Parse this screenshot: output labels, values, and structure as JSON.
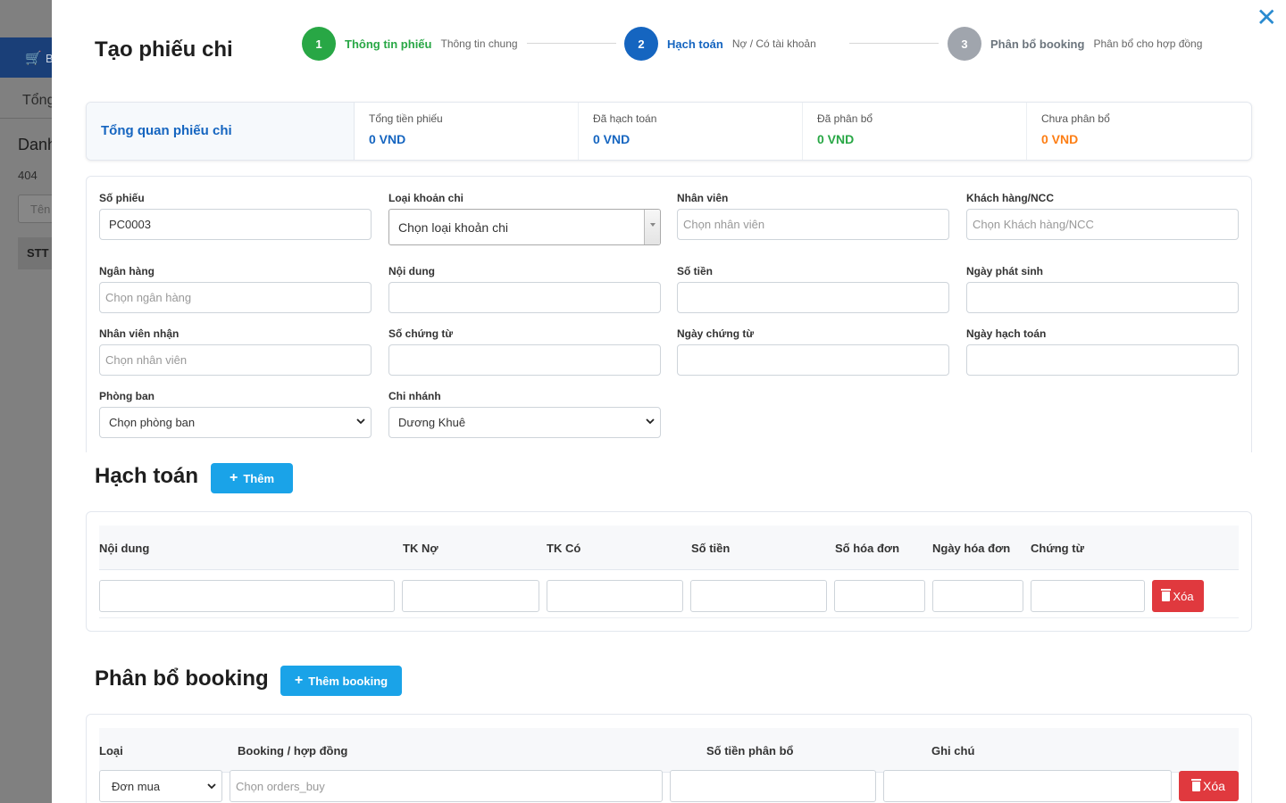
{
  "background": {
    "cart_label": "B",
    "tab_label": "Tổng",
    "title": "Danh",
    "count": "404",
    "search_placeholder": "Tên",
    "col_stt": "STT"
  },
  "modal": {
    "title": "Tạo phiếu chi",
    "close_icon": "close-icon"
  },
  "stepper": [
    {
      "number": "1",
      "label": "Thông tin phiếu",
      "sub": "Thông tin chung",
      "color": "#28a745",
      "label_color": "#28a745"
    },
    {
      "number": "2",
      "label": "Hạch toán",
      "sub": "Nợ / Có tài khoản",
      "color": "#1565c0",
      "label_color": "#1565c0"
    },
    {
      "number": "3",
      "label": "Phân bổ booking",
      "sub": "Phân bổ cho hợp đồng",
      "color": "#a0a5ad",
      "label_color": "#6c757d"
    }
  ],
  "overview": {
    "title": "Tổng quan phiếu chi",
    "items": [
      {
        "label": "Tổng tiền phiếu",
        "value": "0 VND",
        "color": "#1565c0"
      },
      {
        "label": "Đã hạch toán",
        "value": "0 VND",
        "color": "#1565c0"
      },
      {
        "label": "Đã phân bổ",
        "value": "0 VND",
        "color": "#28a745"
      },
      {
        "label": "Chưa phân bổ",
        "value": "0 VND",
        "color": "#fd7e14"
      }
    ]
  },
  "form": {
    "so_phieu": {
      "label": "Số phiếu",
      "value": "PC0003"
    },
    "loai_khoan_chi": {
      "label": "Loại khoản chi",
      "value": "Chọn loại khoản chi"
    },
    "nhan_vien": {
      "label": "Nhân viên",
      "placeholder": "Chọn nhân viên"
    },
    "khach_hang": {
      "label": "Khách hàng/NCC",
      "placeholder": "Chọn Khách hàng/NCC"
    },
    "ngan_hang": {
      "label": "Ngân hàng",
      "placeholder": "Chọn ngân hàng"
    },
    "noi_dung": {
      "label": "Nội dung",
      "value": ""
    },
    "so_tien": {
      "label": "Số tiền",
      "value": ""
    },
    "ngay_phat_sinh": {
      "label": "Ngày phát sinh",
      "value": ""
    },
    "nhan_vien_nhan": {
      "label": "Nhân viên nhận",
      "placeholder": "Chọn nhân viên"
    },
    "so_chung_tu": {
      "label": "Số chứng từ",
      "value": ""
    },
    "ngay_chung_tu": {
      "label": "Ngày chứng từ",
      "value": ""
    },
    "ngay_hach_toan": {
      "label": "Ngày hạch toán",
      "value": ""
    },
    "phong_ban": {
      "label": "Phòng ban",
      "value": "Chọn phòng ban"
    },
    "chi_nhanh": {
      "label": "Chi nhánh",
      "value": "Dương Khuê"
    }
  },
  "hach_toan": {
    "title": "Hạch toán",
    "add_label": "Thêm",
    "columns": [
      "Nội dung",
      "TK Nợ",
      "TK Có",
      "Số tiền",
      "Số hóa đơn",
      "Ngày hóa đơn",
      "Chứng từ"
    ],
    "delete_label": "Xóa"
  },
  "phan_bo": {
    "title": "Phân bổ booking",
    "add_label": "Thêm booking",
    "columns": [
      "Loại",
      "Booking / hợp đồng",
      "Số tiền phân bổ",
      "Ghi chú"
    ],
    "row": {
      "loai": "Đơn mua",
      "booking_placeholder": "Chọn orders_buy"
    },
    "delete_label": "Xóa"
  }
}
